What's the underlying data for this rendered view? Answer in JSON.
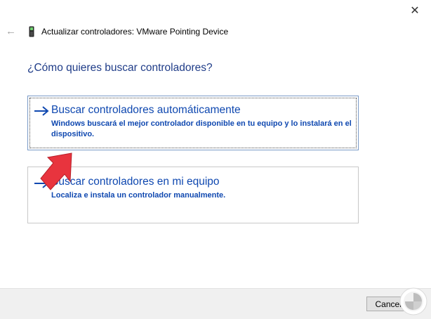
{
  "window": {
    "title": "Actualizar controladores: VMware Pointing Device",
    "close_glyph": "✕",
    "back_glyph": "←"
  },
  "main": {
    "question": "¿Cómo quieres buscar controladores?",
    "options": [
      {
        "title": "Buscar controladores automáticamente",
        "description": "Windows buscará el mejor controlador disponible en tu equipo y lo instalará en el dispositivo."
      },
      {
        "title": "Buscar controladores en mi equipo",
        "description": "Localiza e instala un controlador manualmente."
      }
    ]
  },
  "footer": {
    "cancel_label": "Cancelar"
  },
  "colors": {
    "link_blue": "#0f48b0",
    "heading_blue": "#1f3c88",
    "annotation_red": "#e8343e"
  },
  "icons": [
    "close-icon",
    "back-arrow-icon",
    "device-icon",
    "arrow-right-icon",
    "pointer-annotation-icon",
    "watermark-logo-icon"
  ]
}
